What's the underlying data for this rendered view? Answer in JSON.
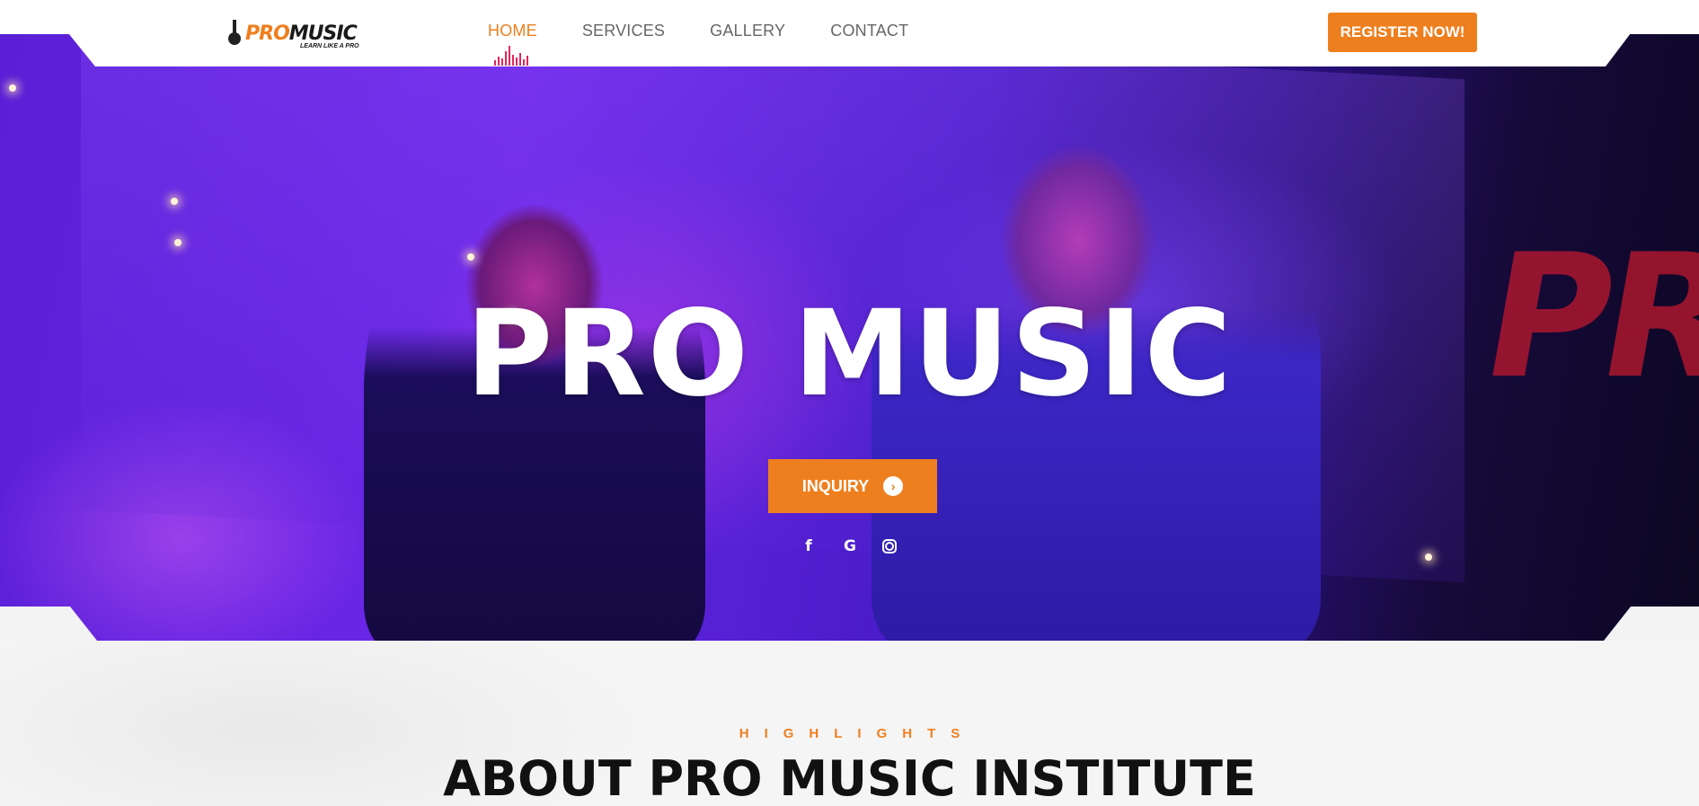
{
  "header": {
    "logo": {
      "pro": "PRO",
      "music": "MUSIC",
      "tagline": "LEARN LIKE A PRO"
    },
    "nav": [
      {
        "label": "HOME",
        "active": true
      },
      {
        "label": "SERVICES",
        "active": false
      },
      {
        "label": "GALLERY",
        "active": false
      },
      {
        "label": "CONTACT",
        "active": false
      }
    ],
    "register_label": "REGISTER NOW!"
  },
  "hero": {
    "title": "PRO MUSIC",
    "inquiry_label": "INQUIRY",
    "socials": [
      "facebook-icon",
      "google-icon",
      "instagram-icon"
    ]
  },
  "about": {
    "label": "HIGHLIGHTS",
    "heading": "ABOUT PRO MUSIC INSTITUTE"
  },
  "colors": {
    "accent": "#ee7f1f",
    "hero_purple": "#5a1fd6",
    "nav_text": "#666666",
    "equalizer": "#e0265a"
  }
}
